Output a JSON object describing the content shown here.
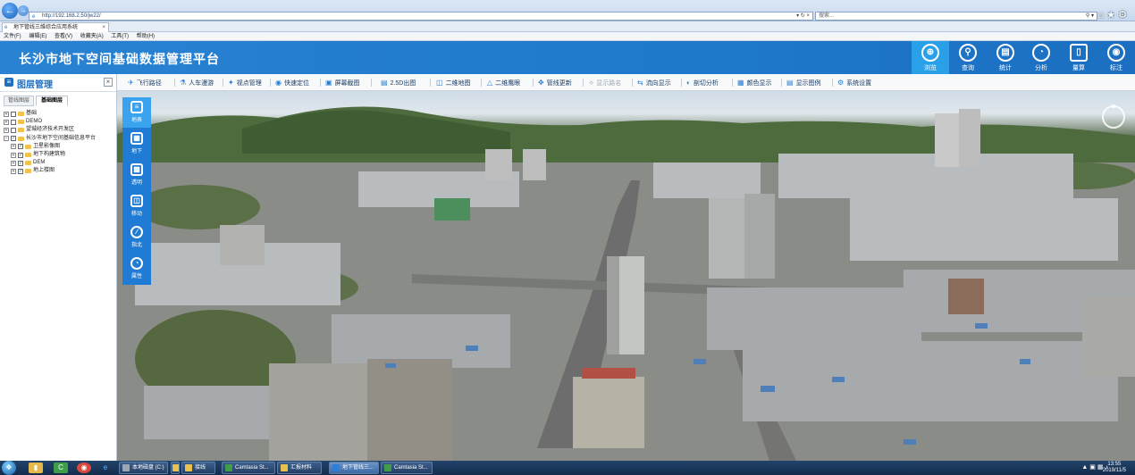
{
  "browser": {
    "url": "http://192.168.2.50/jw22/",
    "search_placeholder": "搜索...",
    "tab_title": "地下管线三维综合应用系统",
    "menu": [
      "文件(F)",
      "编辑(E)",
      "查看(V)",
      "收藏夹(A)",
      "工具(T)",
      "帮助(H)"
    ]
  },
  "app": {
    "title": "长沙市地下空间基础数据管理平台",
    "nav": [
      {
        "label": "浏览",
        "icon": "browse-icon",
        "active": true
      },
      {
        "label": "查询",
        "icon": "query-icon"
      },
      {
        "label": "统计",
        "icon": "statistics-icon"
      },
      {
        "label": "分析",
        "icon": "analysis-icon"
      },
      {
        "label": "量算",
        "icon": "measure-icon"
      },
      {
        "label": "标注",
        "icon": "annotate-icon"
      }
    ]
  },
  "layer_panel": {
    "title": "图层管理",
    "tabs": [
      "管线图层",
      "基础图层"
    ],
    "active_tab": "基础图层",
    "tree": [
      {
        "label": "基础",
        "level": 0,
        "checked": false,
        "expanded": false
      },
      {
        "label": "DEMO",
        "level": 0,
        "checked": false,
        "expanded": false
      },
      {
        "label": "望城经济技术开发区",
        "level": 0,
        "checked": false,
        "expanded": false
      },
      {
        "label": "长沙市地下空间基础信息平台",
        "level": 0,
        "checked": true,
        "expanded": true
      },
      {
        "label": "卫星影像图",
        "level": 1,
        "checked": true,
        "expanded": false
      },
      {
        "label": "地下构建筑物",
        "level": 1,
        "checked": true,
        "expanded": false
      },
      {
        "label": "DEM",
        "level": 1,
        "checked": true,
        "expanded": false
      },
      {
        "label": "地上楼图",
        "level": 1,
        "checked": true,
        "expanded": false
      }
    ]
  },
  "toolbar": {
    "items": [
      {
        "label": "飞行路径",
        "icon": "flight-path-icon"
      },
      {
        "label": "人车漫游",
        "icon": "roam-icon"
      },
      {
        "label": "视点管理",
        "icon": "viewpoint-icon"
      },
      {
        "label": "快速定位",
        "icon": "locate-icon"
      },
      {
        "label": "屏幕截图",
        "icon": "screenshot-icon"
      },
      {
        "label": "2.5D出图",
        "icon": "export-icon"
      },
      {
        "label": "二维地图",
        "icon": "map-2d-icon"
      },
      {
        "label": "二维鹰眼",
        "icon": "eagle-eye-icon"
      },
      {
        "label": "管线更新",
        "icon": "pipeline-update-icon"
      },
      {
        "label": "显示路名",
        "icon": "road-name-icon",
        "disabled": true
      },
      {
        "label": "流向显示",
        "icon": "flow-direction-icon"
      },
      {
        "label": "剖切分析",
        "icon": "section-icon"
      },
      {
        "label": "颜色显示",
        "icon": "color-icon"
      },
      {
        "label": "显示图例",
        "icon": "legend-icon"
      },
      {
        "label": "系统设置",
        "icon": "settings-icon"
      }
    ]
  },
  "side_tools": [
    {
      "label": "地表",
      "icon": "surface-icon",
      "active": true
    },
    {
      "label": "地下",
      "icon": "underground-icon"
    },
    {
      "label": "透明",
      "icon": "transparent-icon"
    },
    {
      "label": "移动",
      "icon": "move-icon"
    },
    {
      "label": "指北",
      "icon": "north-icon"
    },
    {
      "label": "属性",
      "icon": "attribute-icon"
    }
  ],
  "taskbar": {
    "tasks": [
      {
        "label": "本地磁盘 (C:)",
        "color": "#9aa7b5"
      },
      {
        "label": "",
        "color": "#e8c24c"
      },
      {
        "label": "接线",
        "color": "#e8c24c"
      },
      {
        "label": "Camtasia St...",
        "color": "#3f9d4a"
      },
      {
        "label": "汇报材料",
        "color": "#e8c24c"
      },
      {
        "label": "地下管线三...",
        "color": "#2c7fd6",
        "active": true
      },
      {
        "label": "Camtasia St...",
        "color": "#3f9d4a"
      }
    ],
    "time": "13:55",
    "date": "2019/11/5"
  }
}
